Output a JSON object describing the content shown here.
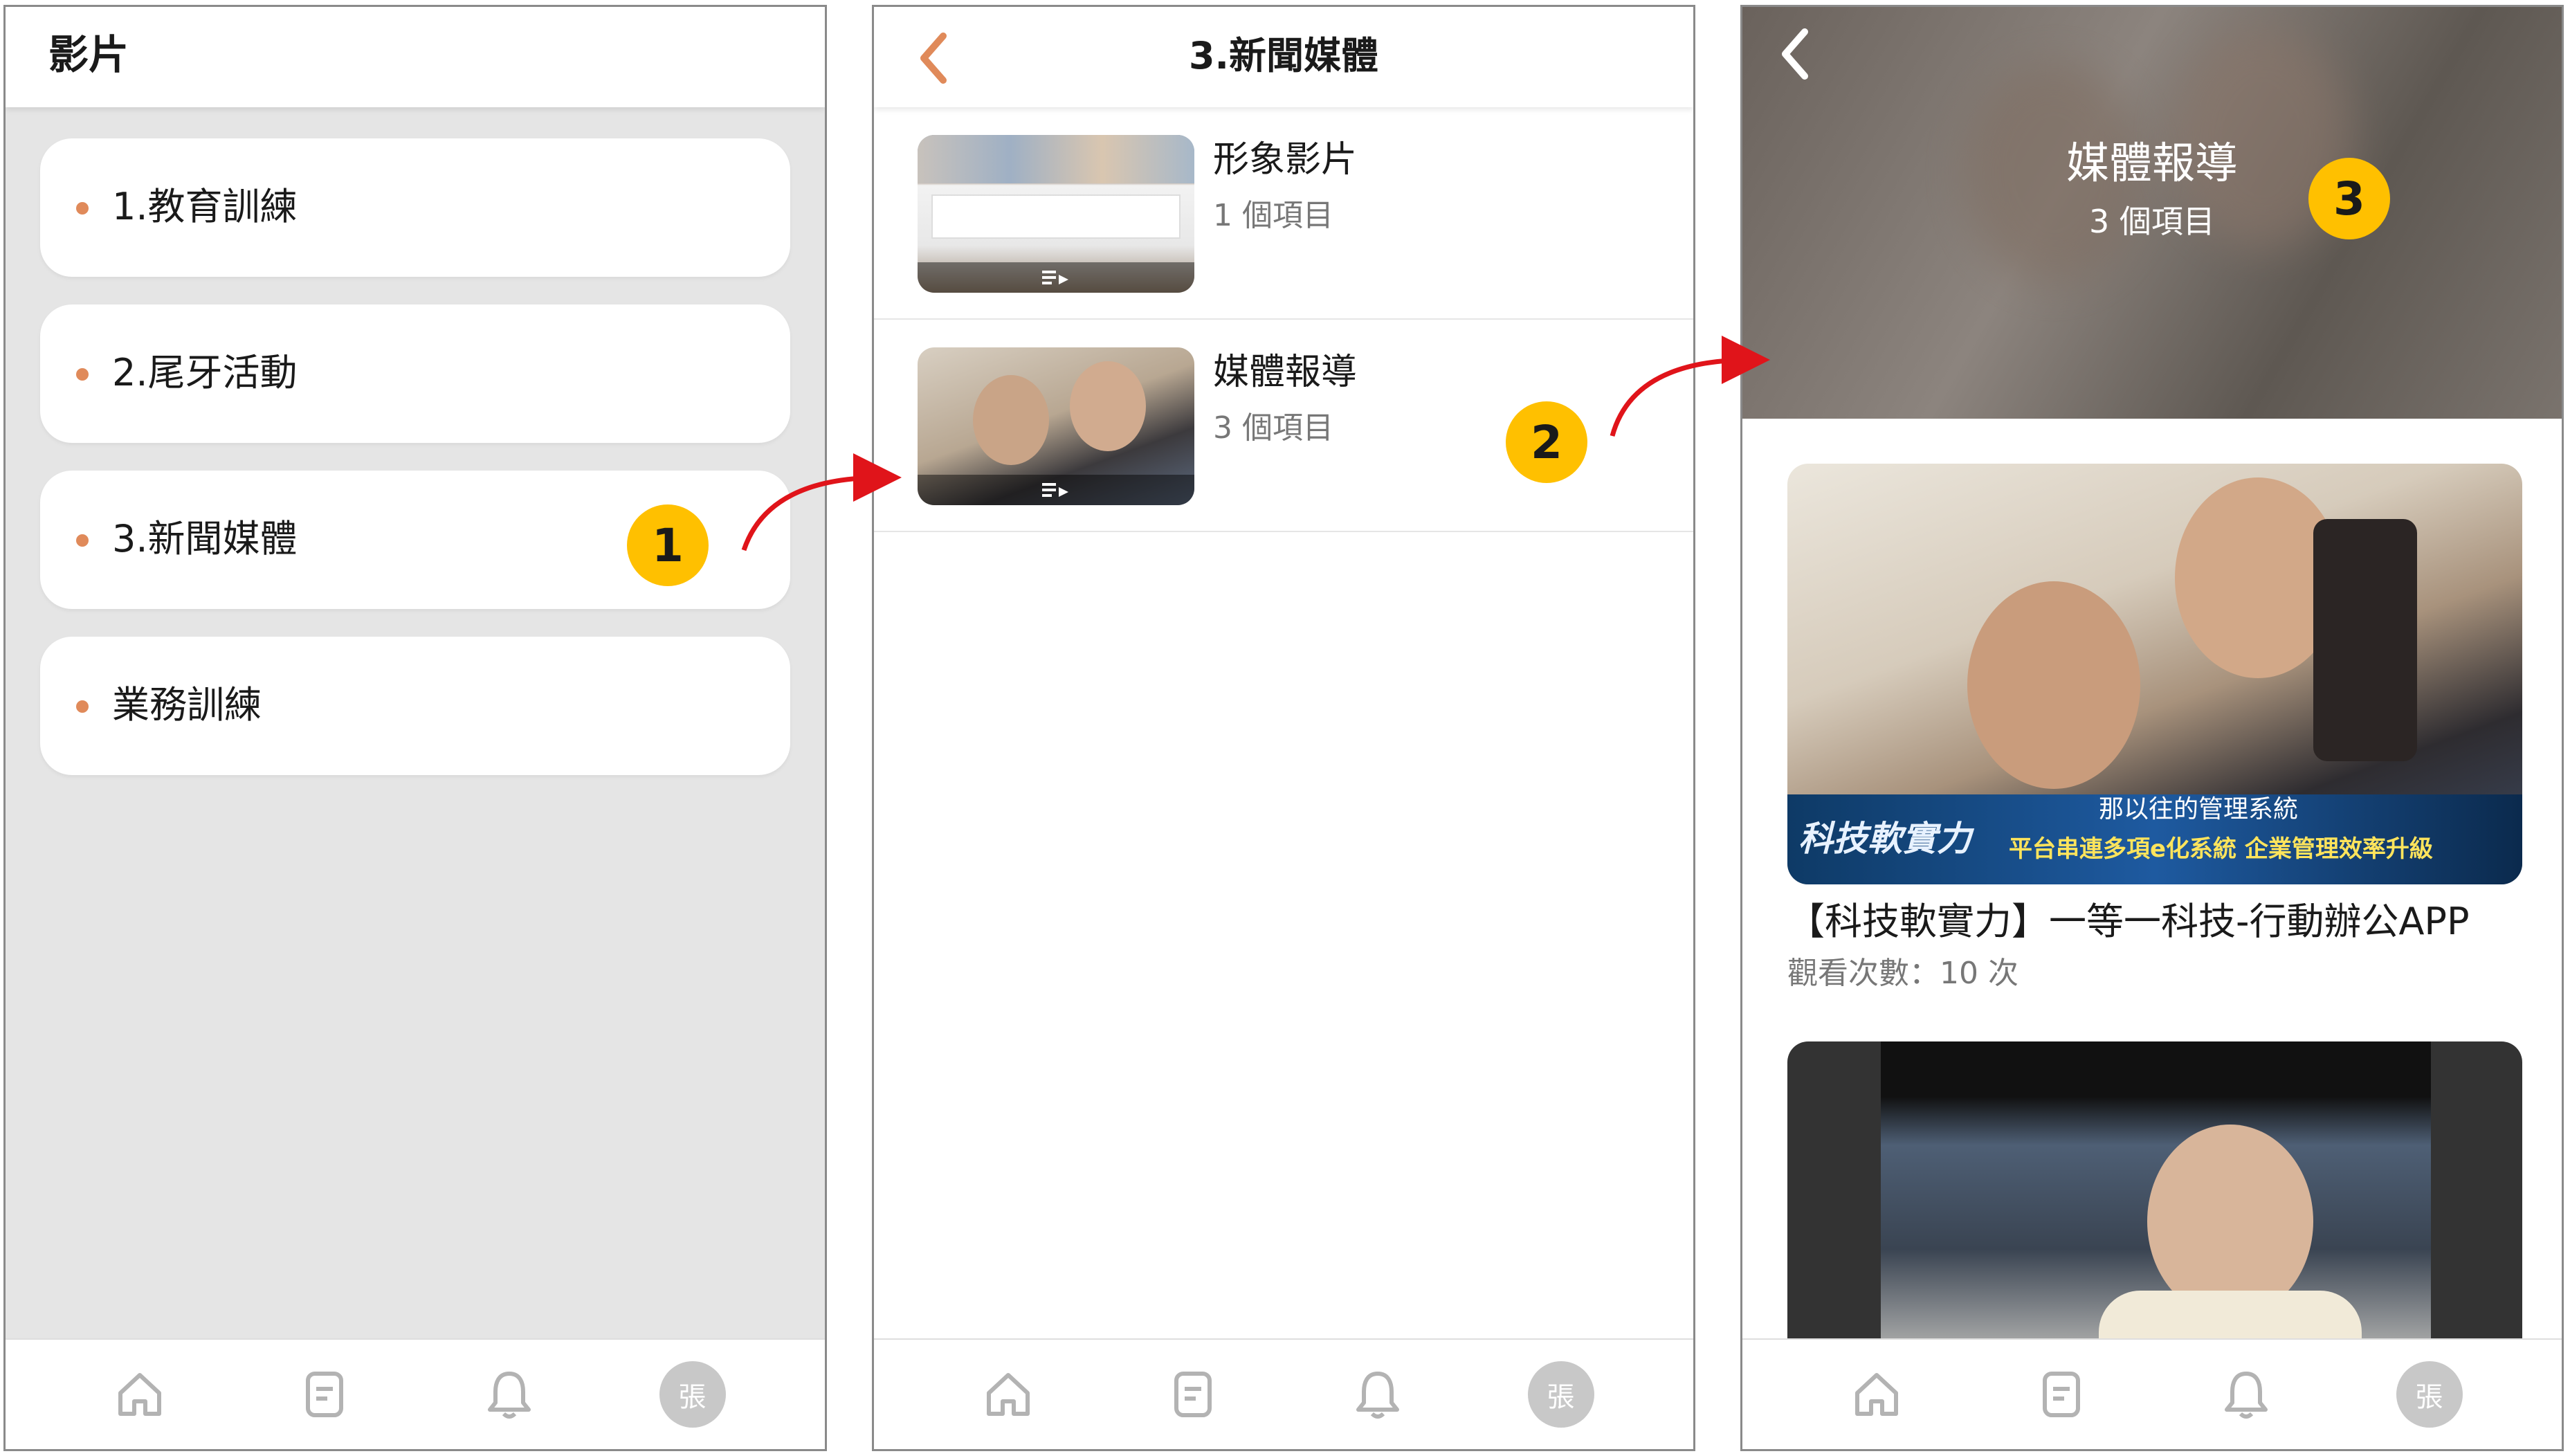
{
  "colors": {
    "accent": "#e08a5a",
    "badge": "#ffc000",
    "arrow": "#e0141a"
  },
  "screen1": {
    "title": "影片",
    "items": [
      {
        "label": "1.教育訓練"
      },
      {
        "label": "2.尾牙活動"
      },
      {
        "label": "3.新聞媒體"
      },
      {
        "label": "業務訓練"
      }
    ]
  },
  "screen2": {
    "title": "3.新聞媒體",
    "rows": [
      {
        "title": "形象影片",
        "count": "1 個項目"
      },
      {
        "title": "媒體報導",
        "count": "3 個項目"
      }
    ]
  },
  "screen3": {
    "hero_title": "媒體報導",
    "hero_count": "3 個項目",
    "videos": [
      {
        "title": "【科技軟實力】一等一科技-行動辦公APP",
        "views": "觀看次數：10 次",
        "overlay_caption": "那以往的管理系統",
        "overlay_ticker": "平台串連多項e化系統 企業管理效率升級",
        "overlay_logo": "科技軟實力"
      }
    ]
  },
  "bottom_nav": {
    "icons": [
      "home-icon",
      "document-icon",
      "bell-icon"
    ],
    "avatar": "張"
  },
  "markers": [
    "1",
    "2",
    "3"
  ]
}
